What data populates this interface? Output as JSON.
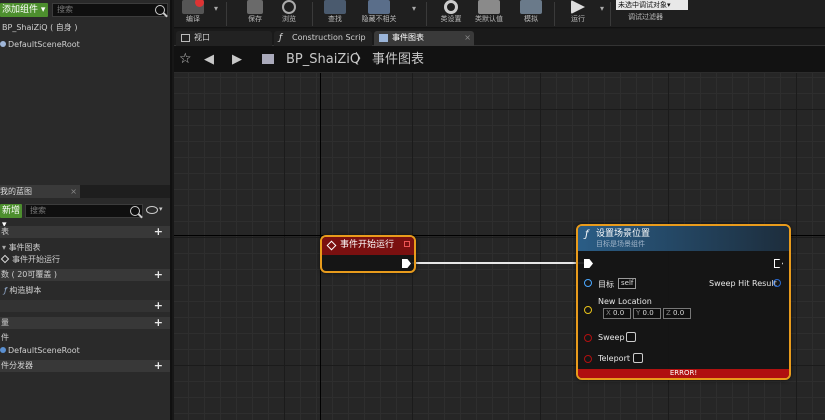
{
  "left_panel": {
    "add_component_label": "添加组件 ▾",
    "search_placeholder": "搜索",
    "self_item": "BP_ShaiZiQ ( 自身 )",
    "default_scene_root": "DefaultSceneRoot",
    "my_blueprint_tab": "我的蓝图",
    "add_new_label": "新增 ▾",
    "search2_placeholder": "搜索",
    "section_graphs": "表",
    "event_graph": "事件图表",
    "begin_play": "事件开始运行",
    "section_functions": "数 ( 20可覆盖 )",
    "construction_script": "构造脚本",
    "section_variables": "量",
    "components_label": "件",
    "default_scene_root2": "DefaultSceneRoot",
    "section_dispatchers": "件分发器"
  },
  "toolbar": {
    "compile": "编译",
    "save": "保存",
    "browse": "浏览",
    "find": "查找",
    "hide_unrelated": "隐藏不相关",
    "class_settings": "类设置",
    "class_defaults": "类默认值",
    "simulate": "模拟",
    "play": "运行",
    "debug_object": "未选中调试对象▾",
    "debug_filter": "调试过滤器"
  },
  "tabs": [
    {
      "label": "视口",
      "active": false
    },
    {
      "label": "Construction Scrip",
      "active": false
    },
    {
      "label": "事件图表",
      "active": true
    }
  ],
  "breadcrumb": {
    "blueprint": "BP_ShaiZiQ",
    "separator": "〉",
    "graph": "事件图表"
  },
  "node_begin": {
    "title": "事件开始运行",
    "header_color": "#7a1010"
  },
  "node_set_location": {
    "title": "设置场景位置",
    "subtitle": "目标是场景组件",
    "target_label": "目标",
    "target_value": "self",
    "new_location_label": "New Location",
    "x_label": "X",
    "x_value": "0.0",
    "y_label": "Y",
    "y_value": "0.0",
    "z_label": "Z",
    "z_value": "0.0",
    "sweep_label": "Sweep",
    "teleport_label": "Teleport",
    "sweep_hit_label": "Sweep Hit Result",
    "error": "ERROR!",
    "header_color": "#2a5d86",
    "error_color": "#b01010"
  }
}
